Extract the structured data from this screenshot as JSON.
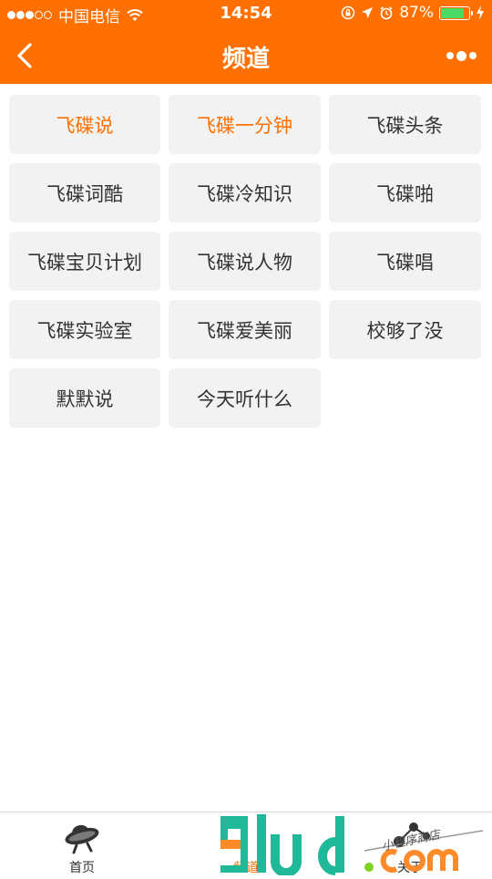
{
  "status_bar": {
    "carrier": "中国电信",
    "time": "14:54",
    "battery_percent": "87%",
    "battery_level": 0.87,
    "signal_bars_filled": 3,
    "signal_bars_total": 5
  },
  "navbar": {
    "title": "频道"
  },
  "channels": [
    {
      "label": "飞碟说",
      "highlighted": true
    },
    {
      "label": "飞碟一分钟",
      "highlighted": true
    },
    {
      "label": "飞碟头条",
      "highlighted": false
    },
    {
      "label": "飞碟词酷",
      "highlighted": false
    },
    {
      "label": "飞碟冷知识",
      "highlighted": false
    },
    {
      "label": "飞碟啪",
      "highlighted": false
    },
    {
      "label": "飞碟宝贝计划",
      "highlighted": false
    },
    {
      "label": "飞碟说人物",
      "highlighted": false
    },
    {
      "label": "飞碟唱",
      "highlighted": false
    },
    {
      "label": "飞碟实验室",
      "highlighted": false
    },
    {
      "label": "飞碟爱美丽",
      "highlighted": false
    },
    {
      "label": "校够了没",
      "highlighted": false
    },
    {
      "label": "默默说",
      "highlighted": false
    },
    {
      "label": "今天听什么",
      "highlighted": false
    }
  ],
  "tabbar": {
    "tabs": [
      {
        "label": "首页",
        "icon": "ufo-icon",
        "active": false
      },
      {
        "label": "频道",
        "icon": "channel-icon",
        "active": true
      },
      {
        "label": "关于",
        "icon": "about-icon",
        "active": false
      }
    ]
  },
  "watermark": {
    "logo_text": "9lud.com",
    "tagline": "小程序商店"
  },
  "colors": {
    "brand": "#ff7000",
    "tile_bg": "#f2f2f2",
    "text": "#333333"
  }
}
